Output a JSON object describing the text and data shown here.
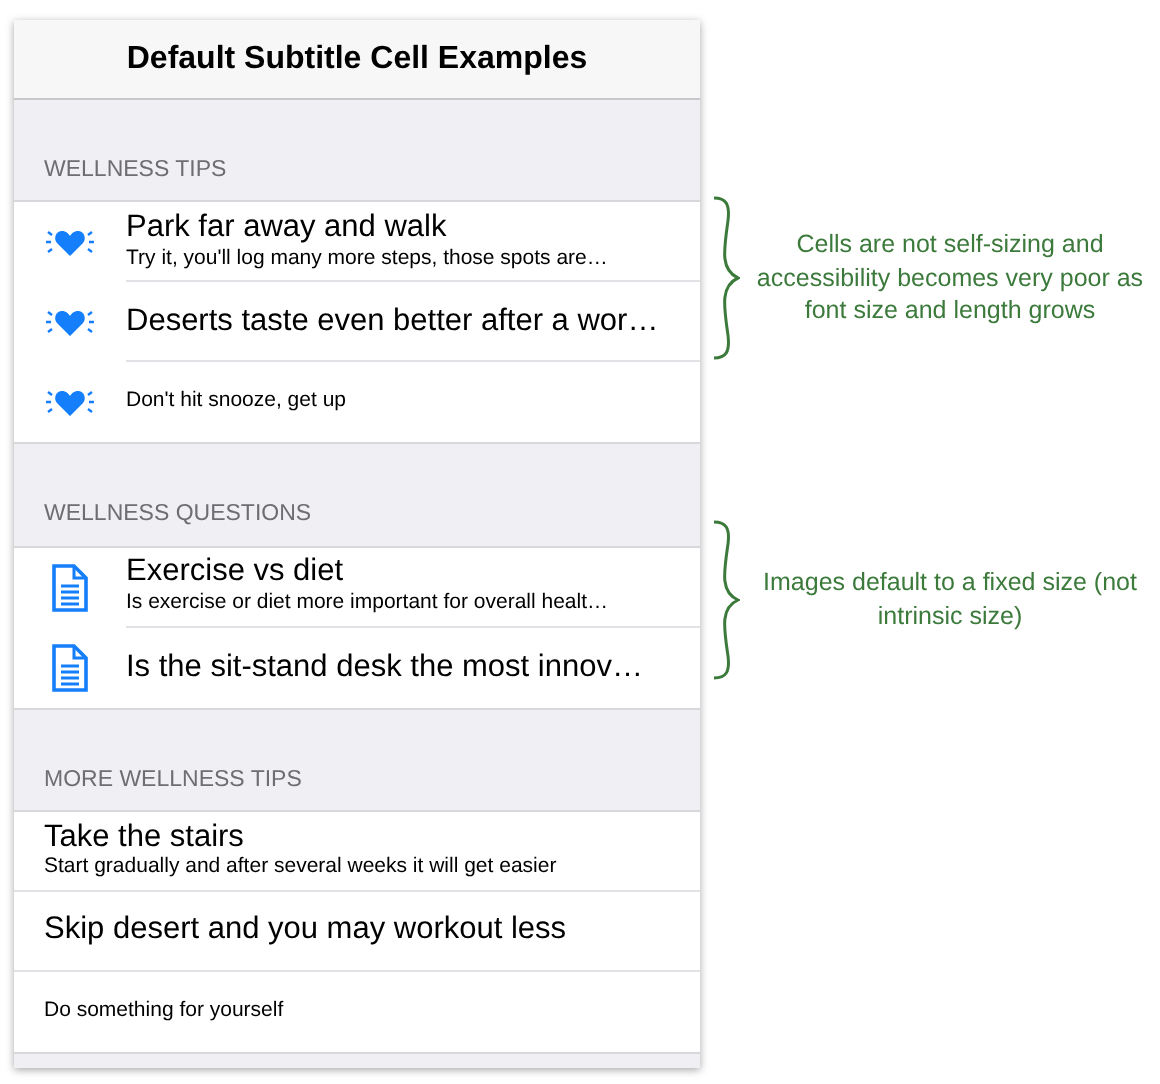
{
  "window": {
    "title": "Default Subtitle Cell Examples"
  },
  "sections": [
    {
      "header": "WELLNESS TIPS",
      "rows": [
        {
          "kind": "heart",
          "title": "Park far away and walk",
          "subtitle": "Try it, you'll log many more steps, those spots are…"
        },
        {
          "kind": "heart",
          "title": "Deserts taste even better after a wor…"
        },
        {
          "kind": "heart",
          "subtitle": "Don't hit snooze, get up"
        }
      ]
    },
    {
      "header": "WELLNESS QUESTIONS",
      "rows": [
        {
          "kind": "document",
          "title": "Exercise vs diet",
          "subtitle": "Is exercise or diet more important for overall healt…"
        },
        {
          "kind": "document",
          "title": "Is the sit-stand desk the most innov…"
        }
      ]
    },
    {
      "header": "MORE WELLNESS TIPS",
      "rows": [
        {
          "kind": "plain",
          "title": "Take the stairs",
          "subtitle": "Start gradually and after several weeks it will get easier"
        },
        {
          "kind": "plain",
          "title": "Skip desert and you may workout less"
        },
        {
          "kind": "plain",
          "subtitle": "Do something for yourself"
        }
      ]
    }
  ],
  "annotations": [
    {
      "text": "Cells are not self-sizing and accessibility becomes very poor as font size and length grows"
    },
    {
      "text": "Images default to a fixed size (not intrinsic size)"
    }
  ]
}
